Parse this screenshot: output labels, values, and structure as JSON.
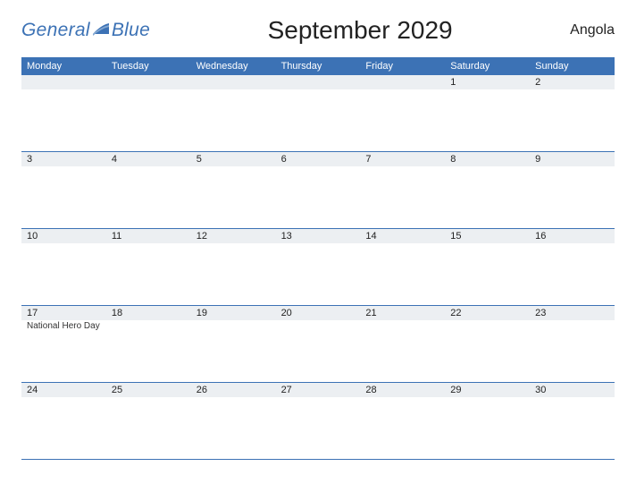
{
  "header": {
    "logo_general": "General",
    "logo_blue": "Blue",
    "title": "September 2029",
    "region": "Angola"
  },
  "dayheads": [
    "Monday",
    "Tuesday",
    "Wednesday",
    "Thursday",
    "Friday",
    "Saturday",
    "Sunday"
  ],
  "weeks": [
    {
      "nums": [
        "",
        "",
        "",
        "",
        "",
        "1",
        "2"
      ],
      "events": [
        "",
        "",
        "",
        "",
        "",
        "",
        ""
      ]
    },
    {
      "nums": [
        "3",
        "4",
        "5",
        "6",
        "7",
        "8",
        "9"
      ],
      "events": [
        "",
        "",
        "",
        "",
        "",
        "",
        ""
      ]
    },
    {
      "nums": [
        "10",
        "11",
        "12",
        "13",
        "14",
        "15",
        "16"
      ],
      "events": [
        "",
        "",
        "",
        "",
        "",
        "",
        ""
      ]
    },
    {
      "nums": [
        "17",
        "18",
        "19",
        "20",
        "21",
        "22",
        "23"
      ],
      "events": [
        "National Hero Day",
        "",
        "",
        "",
        "",
        "",
        ""
      ]
    },
    {
      "nums": [
        "24",
        "25",
        "26",
        "27",
        "28",
        "29",
        "30"
      ],
      "events": [
        "",
        "",
        "",
        "",
        "",
        "",
        ""
      ]
    }
  ]
}
